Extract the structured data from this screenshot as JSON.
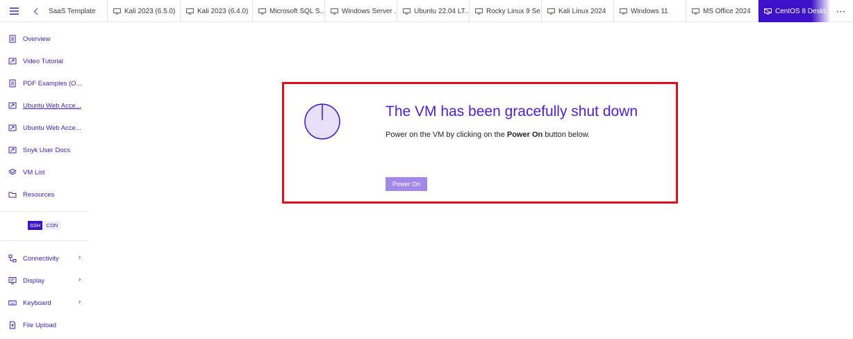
{
  "topbar": {
    "tabs": [
      {
        "label": "SaaS Template",
        "icon": "none"
      },
      {
        "label": "Kali 2023 (6.5.0)",
        "icon": "monitor-icon"
      },
      {
        "label": "Kali 2023 (6.4.0)",
        "icon": "monitor-icon"
      },
      {
        "label": "Microsoft SQL S...",
        "icon": "monitor-icon"
      },
      {
        "label": "Windows Server ...",
        "icon": "monitor-icon"
      },
      {
        "label": "Ubuntu 22.04 LT...",
        "icon": "monitor-icon"
      },
      {
        "label": "Rocky Linux 9 Se...",
        "icon": "monitor-icon"
      },
      {
        "label": "Kali Linux 2024",
        "icon": "monitor-icon"
      },
      {
        "label": "Windows 11",
        "icon": "monitor-icon"
      },
      {
        "label": "MS Office 2024",
        "icon": "monitor-icon"
      },
      {
        "label": "CentOS 8 Deskt...",
        "icon": "monitor-off-icon",
        "active": true
      }
    ],
    "more_label": "⋯"
  },
  "sidebar": {
    "items": [
      {
        "label": "Overview",
        "icon": "document-icon"
      },
      {
        "label": "Video Tutorial",
        "icon": "link-window-icon"
      },
      {
        "label": "PDF Examples (O...",
        "icon": "document-icon"
      },
      {
        "label": "Ubuntu Web Acce...",
        "icon": "link-window-icon"
      },
      {
        "label": "Ubuntu Web Acce...",
        "icon": "link-window-icon"
      },
      {
        "label": "Snyk User Docs",
        "icon": "link-window-icon"
      },
      {
        "label": "VM List",
        "icon": "layers-icon"
      },
      {
        "label": "Resources",
        "icon": "folder-icon"
      }
    ],
    "mode_pills": [
      "SSH",
      "CON"
    ],
    "bottom_items": [
      {
        "label": "Connectivity",
        "icon": "network-icon",
        "chevron": "›"
      },
      {
        "label": "Display",
        "icon": "display-icon",
        "chevron": "›"
      },
      {
        "label": "Keyboard",
        "icon": "keyboard-icon",
        "chevron": "›"
      },
      {
        "label": "File Upload",
        "icon": "file-upload-icon"
      }
    ]
  },
  "vm_status": {
    "title": "The VM has been gracefully shut down",
    "desc_prefix": "Power on the VM by clicking on the ",
    "desc_bold": "Power On",
    "desc_suffix": " button below.",
    "button_label": "Power On"
  },
  "colors": {
    "accent": "#3c12c8",
    "title": "#4b1fd8",
    "button": "#a488e8",
    "highlight_border": "#e0101a",
    "power_circle_fill": "#e6dff8"
  }
}
